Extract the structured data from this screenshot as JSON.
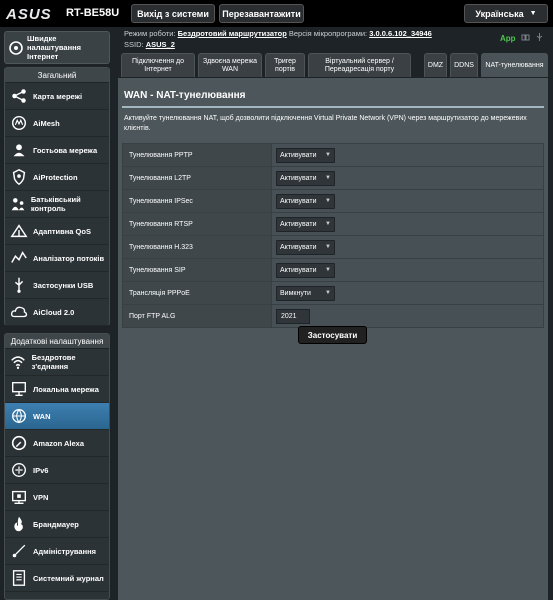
{
  "header": {
    "brand": "ASUS",
    "model": "RT-BE58U",
    "logout_label": "Вихід з системи",
    "reboot_label": "Перезавантажити",
    "language": "Українська"
  },
  "status": {
    "mode_label": "Режим роботи:",
    "mode_value": "Бездротовий маршрутизатор",
    "fw_label": "Версія мікропрограми:",
    "fw_value": "3.0.0.6.102_34946",
    "ssid_label": "SSID:",
    "ssid_value": "ASUS_2",
    "app_label": "App"
  },
  "sidebar": {
    "quick_setup": "Швидке налаштування Інтернет",
    "general_heading": "Загальний",
    "general_items": [
      {
        "label": "Карта мережі",
        "icon": "network-map-icon"
      },
      {
        "label": "AiMesh",
        "icon": "aimesh-icon"
      },
      {
        "label": "Гостьова мережа",
        "icon": "guest-network-icon"
      },
      {
        "label": "AiProtection",
        "icon": "shield-icon"
      },
      {
        "label": "Батьківський контроль",
        "icon": "parental-control-icon"
      },
      {
        "label": "Адаптивна QoS",
        "icon": "qos-icon"
      },
      {
        "label": "Аналізатор потоків",
        "icon": "traffic-analyzer-icon"
      },
      {
        "label": "Застосунки USB",
        "icon": "usb-icon"
      },
      {
        "label": "AiCloud 2.0",
        "icon": "cloud-icon"
      }
    ],
    "advanced_heading": "Додаткові налаштування",
    "advanced_items": [
      {
        "label": "Бездротове з'єднання",
        "icon": "wireless-icon"
      },
      {
        "label": "Локальна мережа",
        "icon": "lan-icon"
      },
      {
        "label": "WAN",
        "icon": "globe-icon",
        "active": true
      },
      {
        "label": "Amazon Alexa",
        "icon": "alexa-icon"
      },
      {
        "label": "IPv6",
        "icon": "ipv6-icon"
      },
      {
        "label": "VPN",
        "icon": "vpn-icon"
      },
      {
        "label": "Брандмауер",
        "icon": "firewall-icon"
      },
      {
        "label": "Адміністрування",
        "icon": "admin-icon"
      },
      {
        "label": "Системний журнал",
        "icon": "syslog-icon"
      }
    ]
  },
  "tabs": [
    {
      "label": "Підключення до Інтернет"
    },
    {
      "label": "Здвоєна мережа WAN"
    },
    {
      "label": "Тригер портів"
    },
    {
      "label": "Віртуальний сервер / Переадресація порту"
    },
    {
      "label": "DMZ"
    },
    {
      "label": "DDNS"
    },
    {
      "label": "NAT-тунелювання",
      "active": true
    }
  ],
  "main": {
    "title": "WAN - NAT-тунелювання",
    "description": "Активуйте тунелювання NAT, щоб дозволити підключення Virtual Private Network (VPN) через маршрутизатор до мережевих клієнтів.",
    "rows": [
      {
        "label": "Тунелювання PPTP",
        "value": "Активувати",
        "type": "select"
      },
      {
        "label": "Тунелювання L2TP",
        "value": "Активувати",
        "type": "select"
      },
      {
        "label": "Тунелювання IPSec",
        "value": "Активувати",
        "type": "select"
      },
      {
        "label": "Тунелювання RTSP",
        "value": "Активувати",
        "type": "select"
      },
      {
        "label": "Тунелювання H.323",
        "value": "Активувати",
        "type": "select"
      },
      {
        "label": "Тунелювання SIP",
        "value": "Активувати",
        "type": "select"
      },
      {
        "label": "Трансляція PPPoE",
        "value": "Вимкнути",
        "type": "select"
      },
      {
        "label": "Порт FTP ALG",
        "value": "2021",
        "type": "text"
      }
    ],
    "apply_label": "Застосувати"
  }
}
